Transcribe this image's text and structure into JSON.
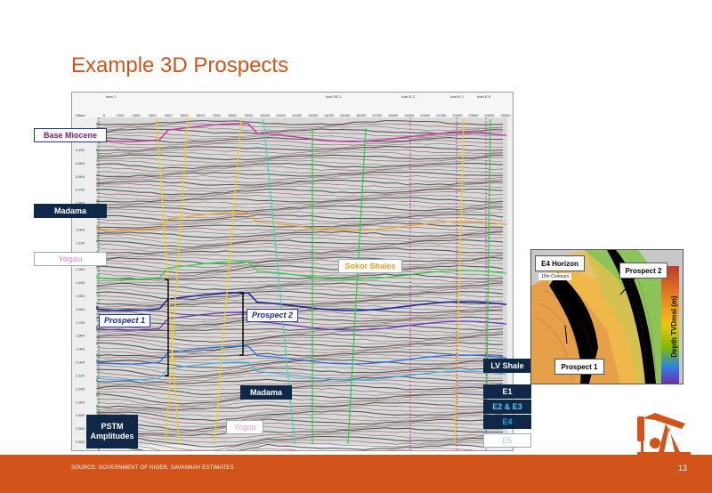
{
  "slide": {
    "title": "Example 3D Prospects",
    "source": "SOURCE: GOVERNMENT OF NIGER, SAVANNAH ESTIMATES",
    "page_number": "13"
  },
  "seismic": {
    "wells": [
      "Inari 1",
      "Inari SE-1",
      "Inari E-2",
      "Inari E-1",
      "Inari E-5"
    ],
    "offset_label": "Offset",
    "offset_ticks": [
      "0",
      "1000",
      "2000",
      "3000",
      "4000",
      "5000",
      "6000",
      "7000",
      "8000",
      "9000",
      "10000",
      "11000",
      "12000",
      "13000",
      "14000",
      "15000",
      "16000",
      "17000",
      "18000",
      "19000",
      "20000",
      "21000",
      "22000",
      "23000",
      "24000",
      "25000"
    ],
    "time_ticks": [
      "0.400",
      "0.500",
      "0.600",
      "0.700",
      "0.800",
      "0.900",
      "1.000",
      "1.100",
      "1.200",
      "1.300",
      "1.400",
      "1.500",
      "1.600",
      "1.700",
      "1.800",
      "1.900",
      "2.000",
      "2.100",
      "2.200",
      "2.300",
      "2.400",
      "2.500",
      "2.600"
    ],
    "labels": {
      "base_miocene": "Base Miocene",
      "madama_upper": "Madama",
      "yogou_upper": "Yogou",
      "sokor_shales": "Sokor Shales",
      "prospect1": "Prospect 1",
      "prospect2": "Prospect 2",
      "madama_lower": "Madama",
      "pstm_line1": "PSTM",
      "pstm_line2": "Amplitudes",
      "yogou_lower": "Yogou",
      "lv_shale": "LV Shale",
      "e1": "E1",
      "e2e3": "E2 & E3",
      "e4": "E4",
      "e5": "E5"
    }
  },
  "inset": {
    "title": "E4 Horizon",
    "subtitle": "10m Contours",
    "prospect1": "Prospect 1",
    "prospect2": "Prospect 2",
    "legend_title": "Depth TVDmsl (m)"
  },
  "colors": {
    "accent": "#d2541a",
    "label_box_dark": "#0f2847",
    "base_miocene": "#8b1a6b",
    "yogou": "#f0a0d8",
    "sokor": "#f0a020",
    "prospect": "#1e2a9a",
    "lv_e": "#0f2847",
    "e4": "#2aa8e8",
    "e5": "#8fd8f8"
  }
}
